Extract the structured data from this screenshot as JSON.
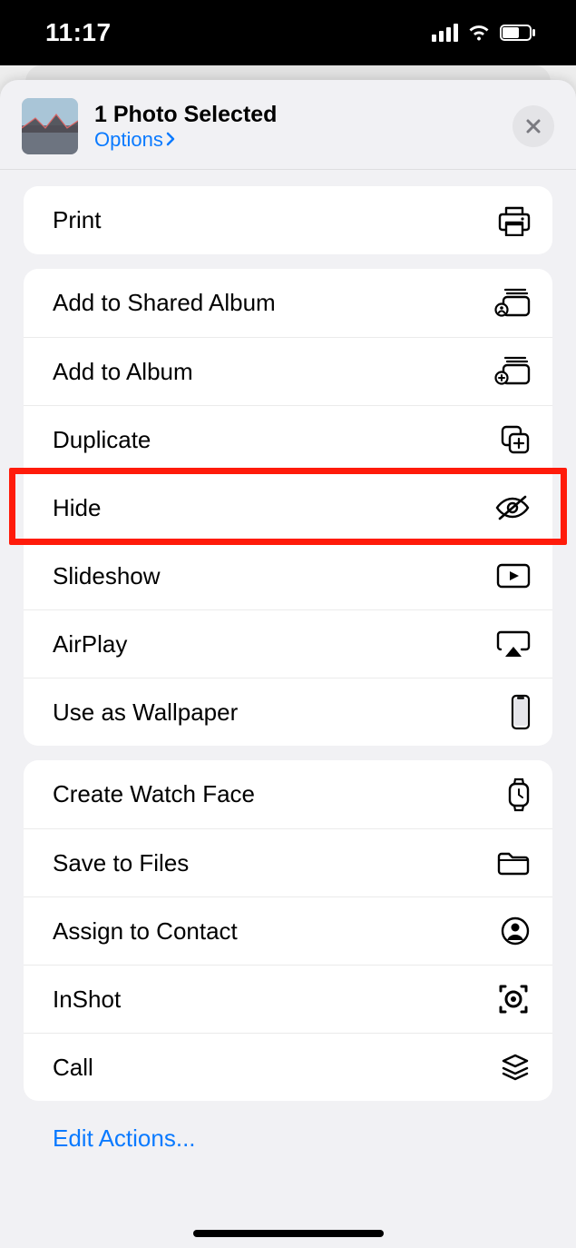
{
  "statusbar": {
    "time": "11:17"
  },
  "header": {
    "title": "1 Photo Selected",
    "options_label": "Options"
  },
  "groups": [
    {
      "rows": [
        {
          "key": "print",
          "label": "Print",
          "icon": "printer-icon"
        }
      ]
    },
    {
      "rows": [
        {
          "key": "add-shared-album",
          "label": "Add to Shared Album",
          "icon": "shared-album-icon"
        },
        {
          "key": "add-album",
          "label": "Add to Album",
          "icon": "album-add-icon"
        },
        {
          "key": "duplicate",
          "label": "Duplicate",
          "icon": "duplicate-icon"
        },
        {
          "key": "hide",
          "label": "Hide",
          "icon": "eye-slash-icon",
          "highlighted": true
        },
        {
          "key": "slideshow",
          "label": "Slideshow",
          "icon": "play-rect-icon"
        },
        {
          "key": "airplay",
          "label": "AirPlay",
          "icon": "airplay-icon"
        },
        {
          "key": "wallpaper",
          "label": "Use as Wallpaper",
          "icon": "phone-icon"
        }
      ]
    },
    {
      "rows": [
        {
          "key": "watch-face",
          "label": "Create Watch Face",
          "icon": "watch-icon"
        },
        {
          "key": "save-files",
          "label": "Save to Files",
          "icon": "folder-icon"
        },
        {
          "key": "assign-contact",
          "label": "Assign to Contact",
          "icon": "contact-icon"
        },
        {
          "key": "inshot",
          "label": "InShot",
          "icon": "inshot-icon"
        },
        {
          "key": "call",
          "label": "Call",
          "icon": "stack-icon"
        }
      ]
    }
  ],
  "footer": {
    "edit_actions_label": "Edit Actions..."
  }
}
